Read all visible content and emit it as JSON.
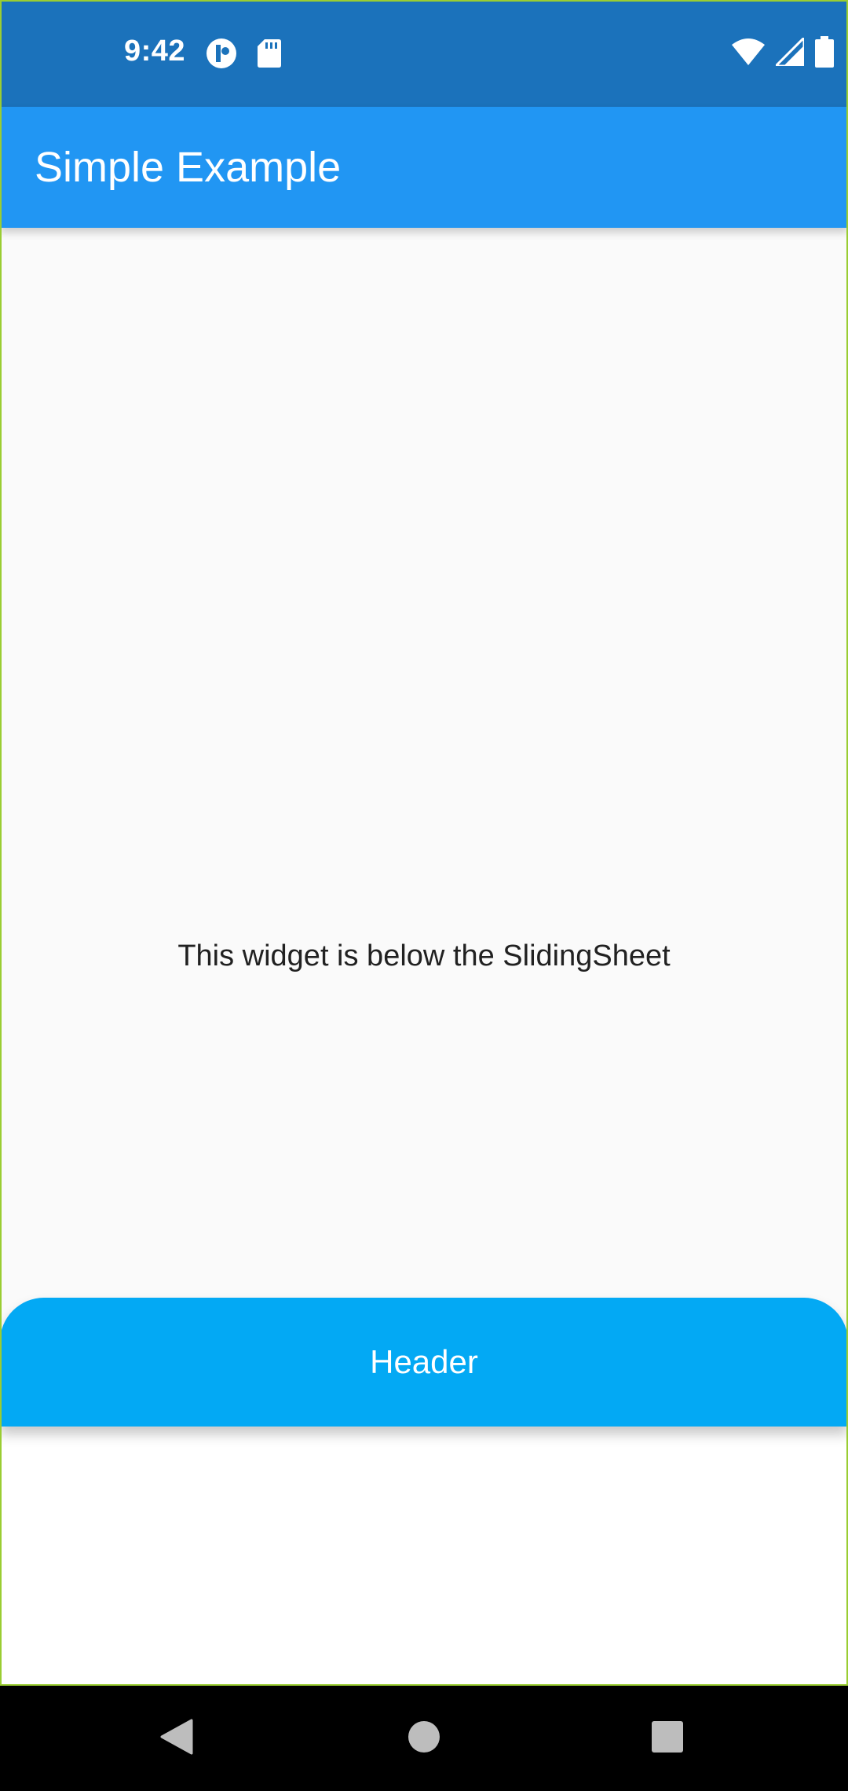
{
  "status_bar": {
    "time": "9:42",
    "left_icons": [
      "notification-app-icon",
      "sd-card-icon"
    ],
    "right_icons": [
      "wifi-icon",
      "cell-signal-icon",
      "battery-icon"
    ],
    "color": "#1b72bb"
  },
  "app_bar": {
    "title": "Simple Example",
    "color": "#2196f3"
  },
  "body": {
    "text": "This widget is below the SlidingSheet"
  },
  "sliding_sheet": {
    "header_label": "Header",
    "header_color": "#03a9f4"
  },
  "nav_bar": {
    "buttons": [
      "back-icon",
      "home-icon",
      "recents-icon"
    ]
  }
}
